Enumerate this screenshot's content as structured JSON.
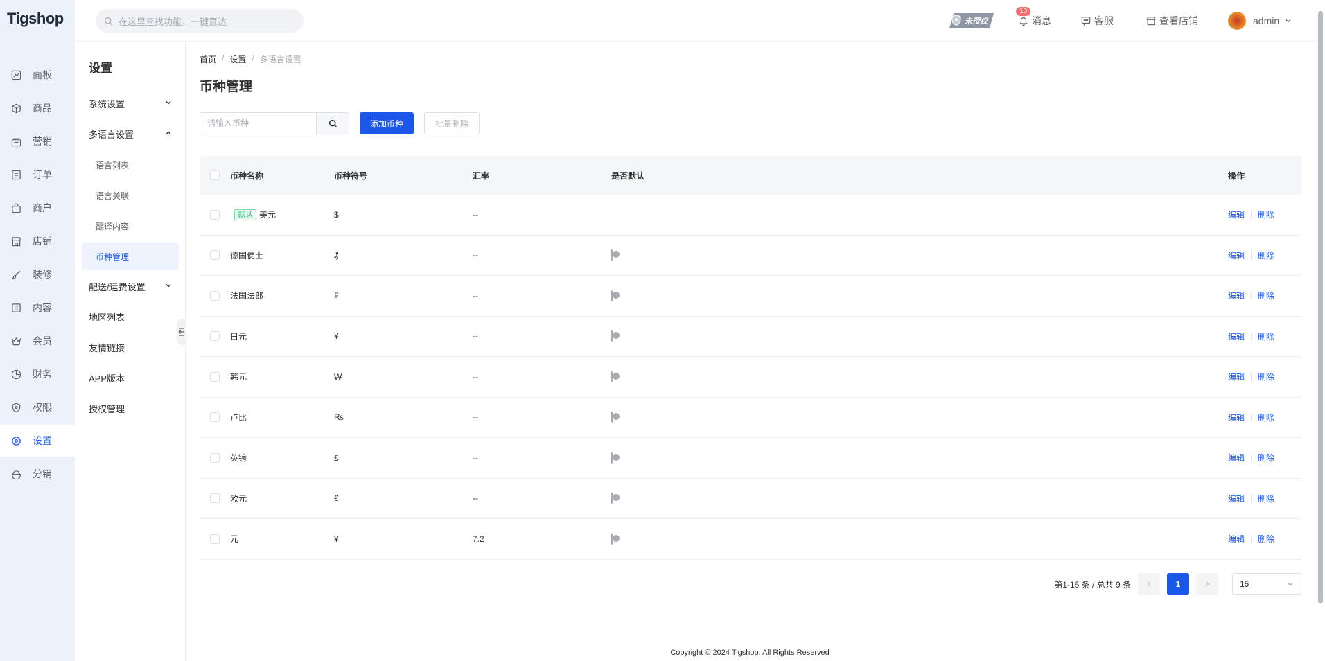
{
  "app": {
    "logo": "Tigshop"
  },
  "header": {
    "search_placeholder": "在这里查找功能，一键直达",
    "auth_badge": "未授权",
    "messages_label": "消息",
    "messages_count": "10",
    "service_label": "客服",
    "view_store_label": "查看店铺",
    "user_name": "admin"
  },
  "leftnav": {
    "items": [
      {
        "label": "面板",
        "icon": "chart-line-icon"
      },
      {
        "label": "商品",
        "icon": "box-icon"
      },
      {
        "label": "营销",
        "icon": "marketing-icon"
      },
      {
        "label": "订单",
        "icon": "order-icon"
      },
      {
        "label": "商户",
        "icon": "bag-icon"
      },
      {
        "label": "店铺",
        "icon": "store-icon"
      },
      {
        "label": "装修",
        "icon": "brush-icon"
      },
      {
        "label": "内容",
        "icon": "content-icon"
      },
      {
        "label": "会员",
        "icon": "crown-icon"
      },
      {
        "label": "财务",
        "icon": "pie-chart-icon"
      },
      {
        "label": "权限",
        "icon": "shield-icon"
      },
      {
        "label": "设置",
        "icon": "gear-icon",
        "active": true
      },
      {
        "label": "分销",
        "icon": "distribution-icon"
      }
    ]
  },
  "subnav": {
    "title": "设置",
    "items": [
      {
        "label": "系统设置"
      },
      {
        "label": "多语言设置"
      },
      {
        "label": "语言列表"
      },
      {
        "label": "语言关联"
      },
      {
        "label": "翻译内容"
      },
      {
        "label": "币种管理"
      },
      {
        "label": "配送/运费设置"
      },
      {
        "label": "地区列表"
      },
      {
        "label": "友情链接"
      },
      {
        "label": "APP版本"
      },
      {
        "label": "授权管理"
      }
    ]
  },
  "breadcrumb": {
    "home": "首页",
    "settings": "设置",
    "current": "多语言设置"
  },
  "page": {
    "title": "币种管理"
  },
  "toolbar": {
    "search_placeholder": "请输入币种",
    "add_label": "添加币种",
    "batch_delete_label": "批量删除"
  },
  "table": {
    "headers": {
      "name": "币种名称",
      "symbol": "币种符号",
      "rate": "汇率",
      "default": "是否默认",
      "actions": "操作"
    },
    "default_tag": "默认",
    "edit_label": "编辑",
    "delete_label": "删除",
    "rows": [
      {
        "name": "美元",
        "symbol": "$",
        "rate": "--",
        "is_default": true
      },
      {
        "name": "德国便士",
        "symbol": "₰",
        "rate": "--",
        "is_default": false
      },
      {
        "name": "法国法郎",
        "symbol": "₣",
        "rate": "--",
        "is_default": false
      },
      {
        "name": "日元",
        "symbol": "¥",
        "rate": "--",
        "is_default": false
      },
      {
        "name": "韩元",
        "symbol": "₩",
        "rate": "--",
        "is_default": false
      },
      {
        "name": "卢比",
        "symbol": "₨",
        "rate": "--",
        "is_default": false
      },
      {
        "name": "英镑",
        "symbol": "£",
        "rate": "--",
        "is_default": false
      },
      {
        "name": "欧元",
        "symbol": "€",
        "rate": "--",
        "is_default": false
      },
      {
        "name": "元",
        "symbol": "¥",
        "rate": "7.2",
        "is_default": false
      }
    ]
  },
  "pagination": {
    "summary": "第1-15 条 / 总共 9 条",
    "current_page": "1",
    "page_size": "15"
  },
  "footer": {
    "copyright": "Copyright © 2024 Tigshop. All Rights Reserved"
  },
  "colors": {
    "accent": "#1a56e8",
    "sidebar_bg": "#edf1fb",
    "badge_red": "#f56c6c",
    "tag_green": "#2bb673"
  }
}
